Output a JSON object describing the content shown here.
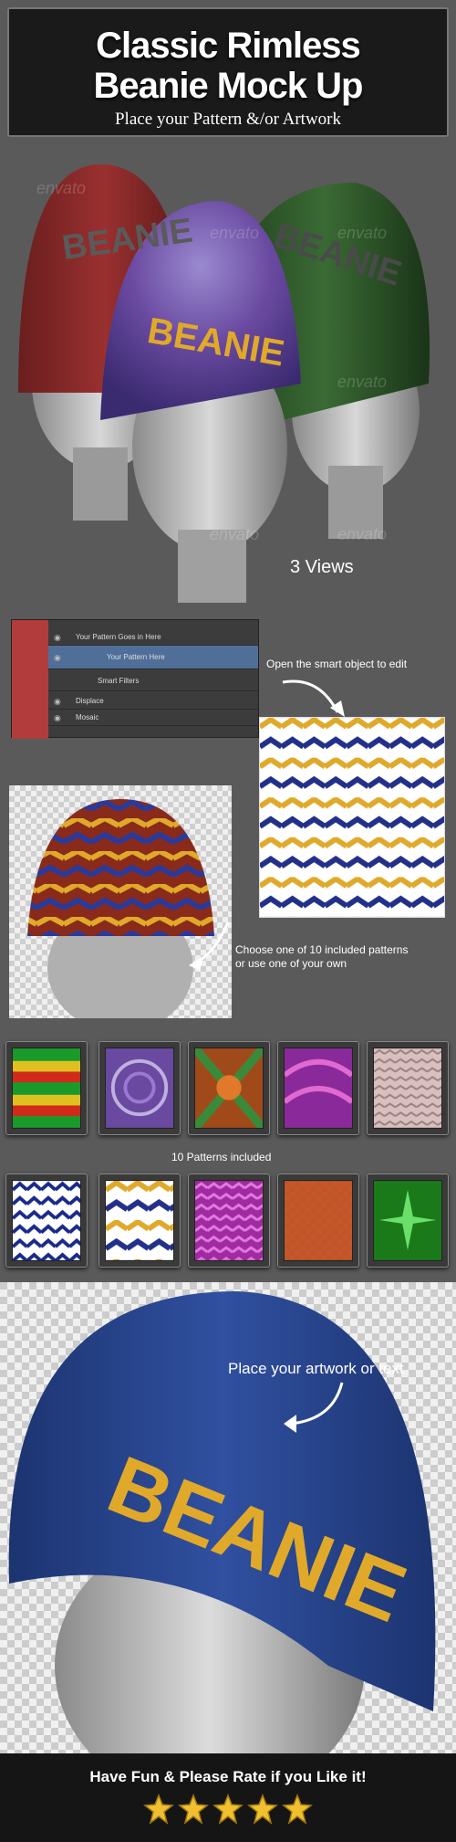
{
  "header": {
    "title_line1": "Classic Rimless",
    "title_line2": "Beanie Mock Up",
    "subtitle": "Place your Pattern  &/or Artwork"
  },
  "watermark": "envato",
  "section1": {
    "views_caption": "3 Views",
    "hat_text": "BEANIE"
  },
  "ps_panel": {
    "group_label": "Your Pattern Goes in Here",
    "layer_label": "Your Pattern Here",
    "filters_label": "Smart Filters",
    "filter1": "Displace",
    "filter2": "Mosaic"
  },
  "captions": {
    "open_smart": "Open the smart object to edit",
    "choose_line1": "Choose one of 10 included patterns",
    "choose_line2": "or use one of your own",
    "patterns_included": "10 Patterns included",
    "place_artwork": "Place your artwork or text"
  },
  "bighat": {
    "text": "BEANIE"
  },
  "footer": {
    "text": "Have Fun & Please Rate if you Like it!",
    "rating": 5
  },
  "colors": {
    "hat_red": "#8e2a2a",
    "hat_green": "#2e5a2a",
    "hat_purple": "#6a4aa0",
    "hat_blue": "#2a4a8a",
    "gold": "#e0a92a",
    "star": "#f0c030"
  }
}
